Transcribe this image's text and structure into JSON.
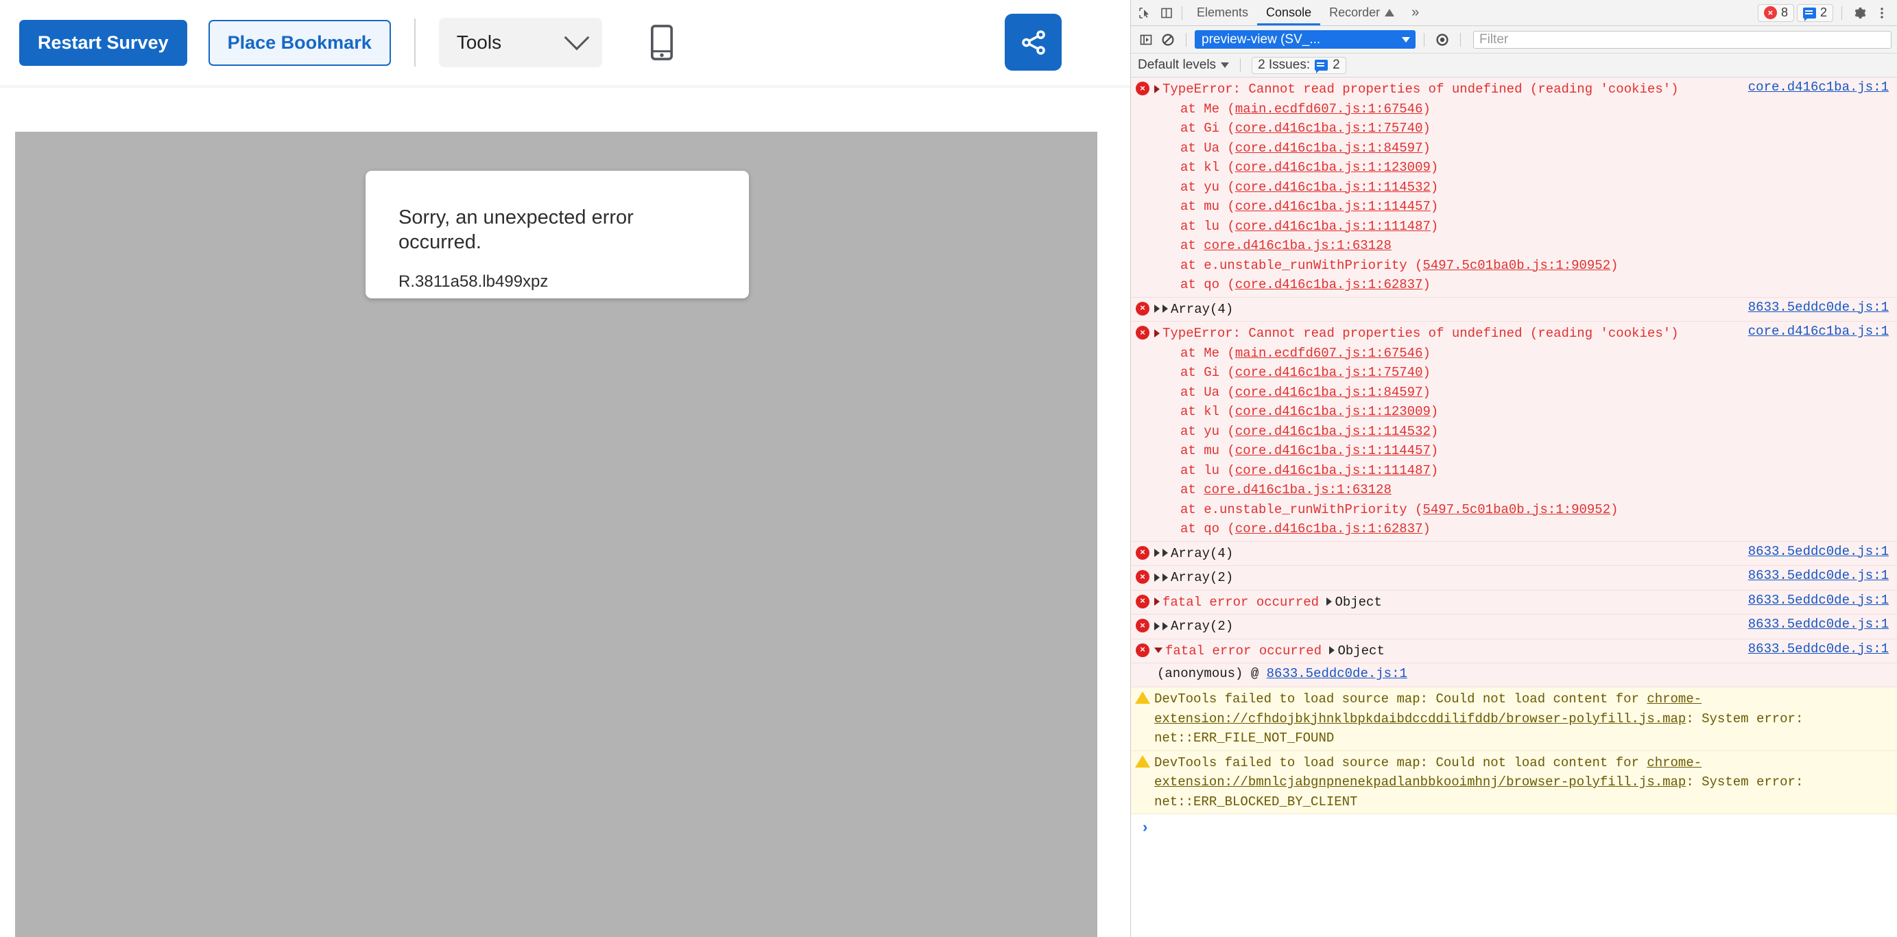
{
  "survey_app": {
    "toolbar": {
      "restart_label": "Restart Survey",
      "bookmark_label": "Place Bookmark",
      "tools_label": "Tools",
      "mobile_icon": "mobile-phone-icon",
      "share_icon": "share-nodes-icon",
      "chevron_icon": "chevron-down-icon",
      "accent_color": "#1668c5"
    },
    "preview": {
      "background_color": "#b3b3b3",
      "error_card": {
        "title": "Sorry, an unexpected error occurred.",
        "code": "R.3811a58.lb499xpz"
      }
    }
  },
  "devtools": {
    "tabbar": {
      "inspect_icon": "inspect-cursor-icon",
      "device_icon": "device-toolbar-icon",
      "tabs": [
        {
          "label": "Elements",
          "active": false
        },
        {
          "label": "Console",
          "active": true
        },
        {
          "label": "Recorder",
          "active": false,
          "suffix_icon": "triangle-up-icon"
        }
      ],
      "more_tabs_label": "»",
      "error_badge": "8",
      "issue_badge": "2",
      "settings_icon": "gear-icon",
      "menu_icon": "kebab-menu-icon"
    },
    "filterbar": {
      "sidebar_icon": "console-sidebar-toggle-icon",
      "clear_icon": "clear-console-icon",
      "context_value": "preview-view (SV_...",
      "eye_icon": "live-expression-eye-icon",
      "filter_placeholder": "Filter",
      "filter_value": ""
    },
    "levelbar": {
      "levels_label": "Default levels",
      "issues_label": "2 Issues:",
      "issues_count": "2"
    },
    "console_rows": [
      {
        "kind": "error",
        "disclosure": "collapsed",
        "message": "TypeError: Cannot read properties of undefined (reading 'cookies')",
        "source": "core.d416c1ba.js:1",
        "stack": [
          {
            "fn": "at Me (",
            "link": "main.ecdfd607.js:1:67546",
            "close": ")"
          },
          {
            "fn": "at Gi (",
            "link": "core.d416c1ba.js:1:75740",
            "close": ")"
          },
          {
            "fn": "at Ua (",
            "link": "core.d416c1ba.js:1:84597",
            "close": ")"
          },
          {
            "fn": "at kl (",
            "link": "core.d416c1ba.js:1:123009",
            "close": ")"
          },
          {
            "fn": "at yu (",
            "link": "core.d416c1ba.js:1:114532",
            "close": ")"
          },
          {
            "fn": "at mu (",
            "link": "core.d416c1ba.js:1:114457",
            "close": ")"
          },
          {
            "fn": "at lu (",
            "link": "core.d416c1ba.js:1:111487",
            "close": ")"
          },
          {
            "fn": "at ",
            "link": "core.d416c1ba.js:1:63128",
            "close": ""
          },
          {
            "fn": "at e.unstable_runWithPriority (",
            "link": "5497.5c01ba0b.js:1:90952",
            "close": ")"
          },
          {
            "fn": "at qo (",
            "link": "core.d416c1ba.js:1:62837",
            "close": ")"
          }
        ]
      },
      {
        "kind": "error",
        "disclosure": "double-collapsed",
        "message": "Array(4)",
        "source": "8633.5eddc0de.js:1",
        "stack": []
      },
      {
        "kind": "error",
        "disclosure": "collapsed",
        "message": "TypeError: Cannot read properties of undefined (reading 'cookies')",
        "source": "core.d416c1ba.js:1",
        "stack": [
          {
            "fn": "at Me (",
            "link": "main.ecdfd607.js:1:67546",
            "close": ")"
          },
          {
            "fn": "at Gi (",
            "link": "core.d416c1ba.js:1:75740",
            "close": ")"
          },
          {
            "fn": "at Ua (",
            "link": "core.d416c1ba.js:1:84597",
            "close": ")"
          },
          {
            "fn": "at kl (",
            "link": "core.d416c1ba.js:1:123009",
            "close": ")"
          },
          {
            "fn": "at yu (",
            "link": "core.d416c1ba.js:1:114532",
            "close": ")"
          },
          {
            "fn": "at mu (",
            "link": "core.d416c1ba.js:1:114457",
            "close": ")"
          },
          {
            "fn": "at lu (",
            "link": "core.d416c1ba.js:1:111487",
            "close": ")"
          },
          {
            "fn": "at ",
            "link": "core.d416c1ba.js:1:63128",
            "close": ""
          },
          {
            "fn": "at e.unstable_runWithPriority (",
            "link": "5497.5c01ba0b.js:1:90952",
            "close": ")"
          },
          {
            "fn": "at qo (",
            "link": "core.d416c1ba.js:1:62837",
            "close": ")"
          }
        ]
      },
      {
        "kind": "error",
        "disclosure": "double-collapsed",
        "message": "Array(4)",
        "source": "8633.5eddc0de.js:1",
        "stack": []
      },
      {
        "kind": "error",
        "disclosure": "double-collapsed",
        "message": "Array(2)",
        "source": "8633.5eddc0de.js:1",
        "stack": []
      },
      {
        "kind": "error",
        "disclosure": "collapsed",
        "message": "fatal error occurred",
        "object_label": "Object",
        "source": "8633.5eddc0de.js:1",
        "stack": []
      },
      {
        "kind": "error",
        "disclosure": "double-collapsed",
        "message": "Array(2)",
        "source": "8633.5eddc0de.js:1",
        "stack": []
      },
      {
        "kind": "error",
        "disclosure": "expanded",
        "message": "fatal error occurred",
        "object_label": "Object",
        "source": "8633.5eddc0de.js:1",
        "stack": [],
        "sub_line": {
          "text": "(anonymous) @ ",
          "link": "8633.5eddc0de.js:1"
        }
      },
      {
        "kind": "warning",
        "prefix": "DevTools failed to load source map: Could not load content for ",
        "link": "chrome-extension://cfhdojbkjhnklbpkdaibdccddilifddb/browser-polyfill.js.map",
        "suffix": ": System error: net::ERR_FILE_NOT_FOUND"
      },
      {
        "kind": "warning",
        "prefix": "DevTools failed to load source map: Could not load content for ",
        "link": "chrome-extension://bmnlcjabgnpnenekpadlanbbkooimhnj/browser-polyfill.js.map",
        "suffix": ": System error: net::ERR_BLOCKED_BY_CLIENT"
      }
    ],
    "prompt": {
      "chevron": "›"
    }
  }
}
